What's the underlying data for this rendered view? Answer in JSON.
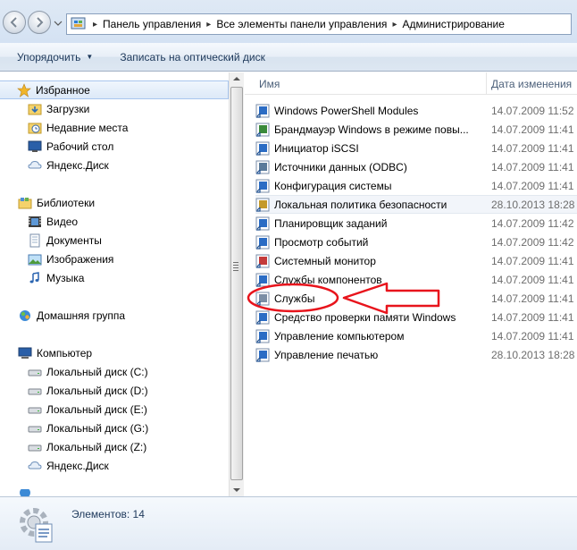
{
  "address": {
    "crumbs": [
      "Панель управления",
      "Все элементы панели управления",
      "Администрирование"
    ]
  },
  "toolbar": {
    "organize_label": "Упорядочить",
    "burn_label": "Записать на оптический диск"
  },
  "nav": {
    "favorites": {
      "label": "Избранное",
      "items": [
        {
          "label": "Загрузки",
          "icon": "downloads-folder-icon"
        },
        {
          "label": "Недавние места",
          "icon": "recent-places-icon"
        },
        {
          "label": "Рабочий стол",
          "icon": "desktop-icon"
        },
        {
          "label": "Яндекс.Диск",
          "icon": "yandex-disk-icon"
        }
      ]
    },
    "libraries": {
      "label": "Библиотеки",
      "items": [
        {
          "label": "Видео",
          "icon": "video-library-icon"
        },
        {
          "label": "Документы",
          "icon": "documents-library-icon"
        },
        {
          "label": "Изображения",
          "icon": "pictures-library-icon"
        },
        {
          "label": "Музыка",
          "icon": "music-library-icon"
        }
      ]
    },
    "homegroup": {
      "label": "Домашняя группа"
    },
    "computer": {
      "label": "Компьютер",
      "items": [
        {
          "label": "Локальный диск (C:)",
          "icon": "drive-icon"
        },
        {
          "label": "Локальный диск (D:)",
          "icon": "drive-icon"
        },
        {
          "label": "Локальный диск (E:)",
          "icon": "drive-icon"
        },
        {
          "label": "Локальный диск (G:)",
          "icon": "drive-icon"
        },
        {
          "label": "Локальный диск (Z:)",
          "icon": "drive-icon"
        },
        {
          "label": "Яндекс.Диск",
          "icon": "yandex-disk-icon"
        }
      ]
    }
  },
  "files": {
    "columns": {
      "name": "Имя",
      "date": "Дата изменения"
    },
    "rows": [
      {
        "name": "Windows PowerShell Modules",
        "date": "14.07.2009 11:52"
      },
      {
        "name": "Брандмауэр Windows в режиме повы...",
        "date": "14.07.2009 11:41"
      },
      {
        "name": "Инициатор iSCSI",
        "date": "14.07.2009 11:41"
      },
      {
        "name": "Источники данных (ODBC)",
        "date": "14.07.2009 11:41"
      },
      {
        "name": "Конфигурация системы",
        "date": "14.07.2009 11:41"
      },
      {
        "name": "Локальная политика безопасности",
        "date": "28.10.2013 18:28"
      },
      {
        "name": "Планировщик заданий",
        "date": "14.07.2009 11:42"
      },
      {
        "name": "Просмотр событий",
        "date": "14.07.2009 11:42"
      },
      {
        "name": "Системный монитор",
        "date": "14.07.2009 11:41"
      },
      {
        "name": "Службы компонентов",
        "date": "14.07.2009 11:41"
      },
      {
        "name": "Службы",
        "date": "14.07.2009 11:41"
      },
      {
        "name": "Средство проверки памяти Windows",
        "date": "14.07.2009 11:41"
      },
      {
        "name": "Управление компьютером",
        "date": "14.07.2009 11:41"
      },
      {
        "name": "Управление печатью",
        "date": "28.10.2013 18:28"
      }
    ]
  },
  "details": {
    "count_label": "Элементов: 14"
  },
  "colors": {
    "annotation": "#e8141c",
    "selection_border": "#a9c6ee"
  }
}
